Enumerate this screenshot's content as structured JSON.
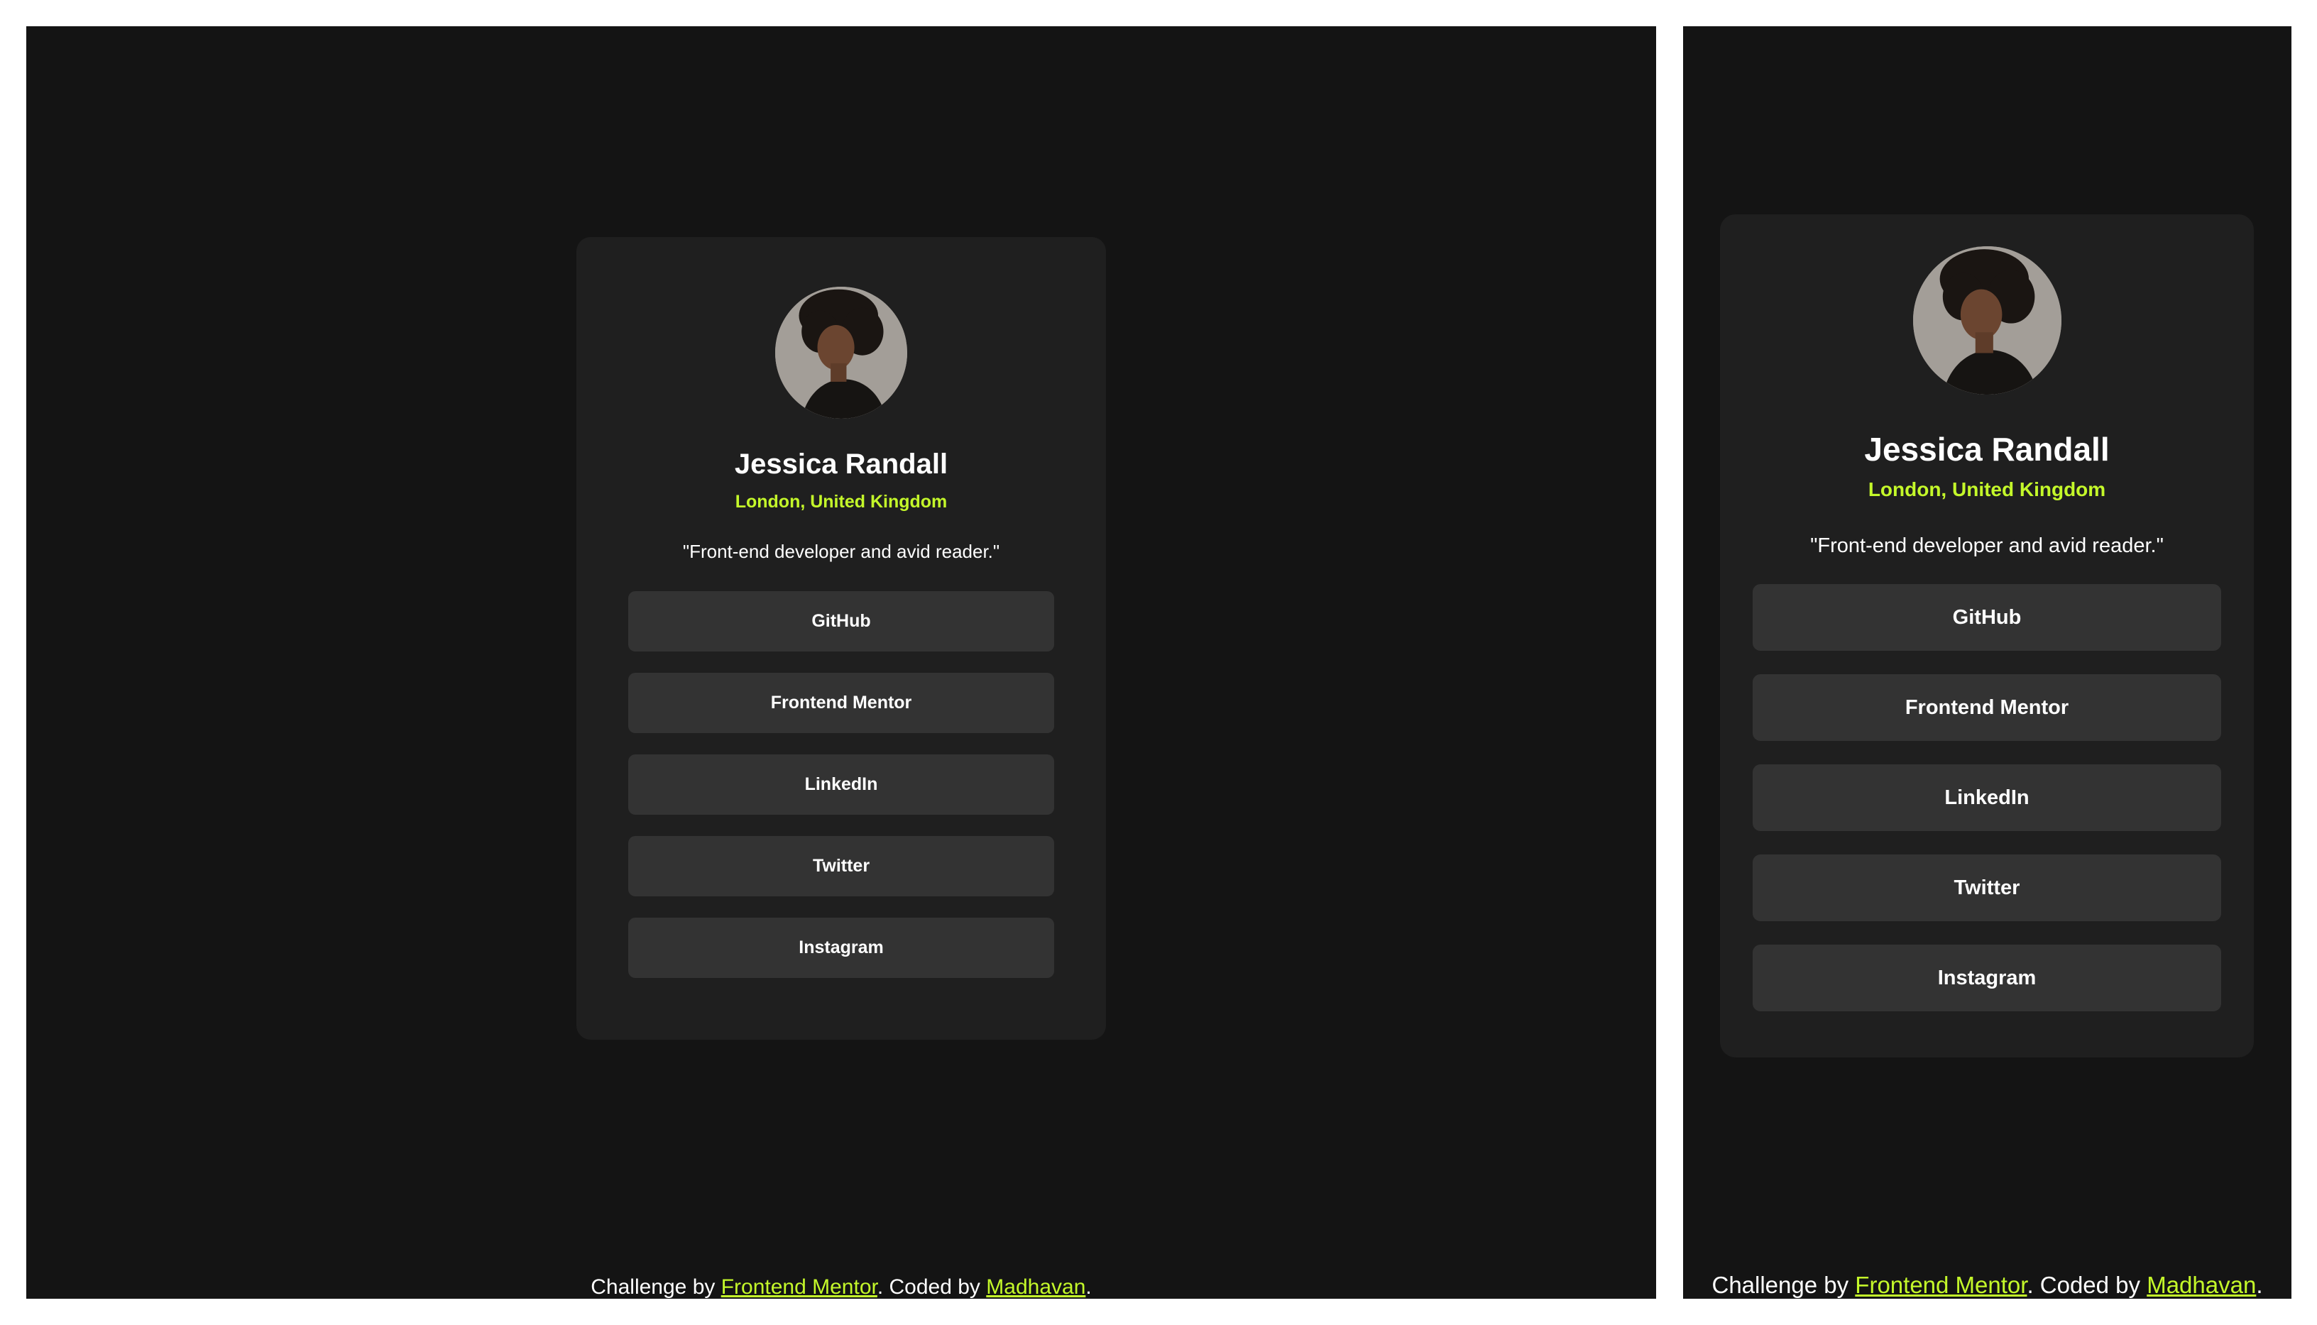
{
  "profile": {
    "name": "Jessica Randall",
    "location": "London, United Kingdom",
    "bio": "\"Front-end developer and avid reader.\"",
    "links": [
      {
        "label": "GitHub"
      },
      {
        "label": "Frontend Mentor"
      },
      {
        "label": "LinkedIn"
      },
      {
        "label": "Twitter"
      },
      {
        "label": "Instagram"
      }
    ]
  },
  "attribution": {
    "prefix": "Challenge by ",
    "challenge_link": "Frontend Mentor",
    "middle": ". Coded by ",
    "author_link": "Madhavan",
    "suffix": "."
  },
  "colors": {
    "page_background": "#141414",
    "card_background": "#1f1f1f",
    "button_background": "#333333",
    "accent": "#c4f82a",
    "text": "#ffffff"
  },
  "icons": {
    "avatar": "avatar-photo"
  }
}
